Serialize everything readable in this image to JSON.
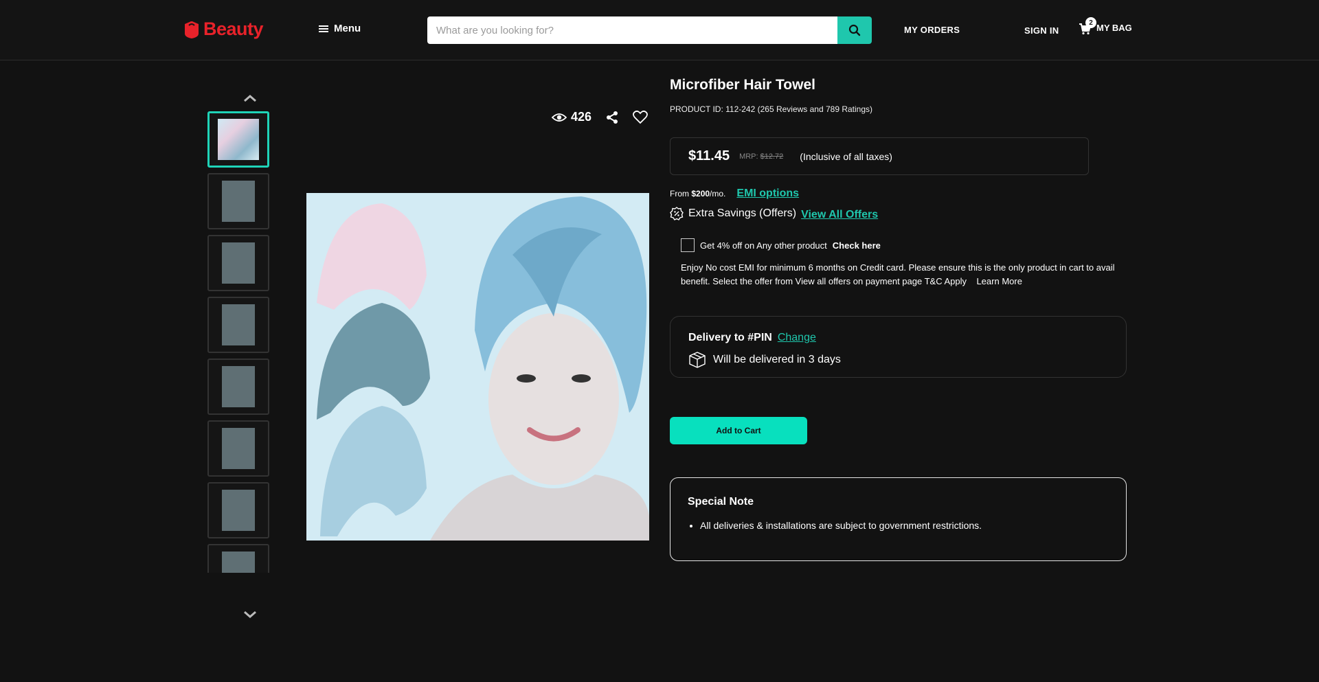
{
  "header": {
    "logo": "Beauty",
    "menu_label": "Menu",
    "search_placeholder": "What are you looking for?",
    "my_orders": "MY ORDERS",
    "sign_in": "SIGN IN",
    "bag_count": "2",
    "bag_label": "MY BAG"
  },
  "gallery": {
    "views": "426",
    "thumbnail_count": 8
  },
  "product": {
    "title": "Microfiber Hair Towel",
    "product_id_line": "PRODUCT ID: 112-242 (265 Reviews and 789 Ratings)",
    "price": "$11.45",
    "mrp_label": "MRP:",
    "mrp_value": "$12.72",
    "tax_note": "(Inclusive of all taxes)",
    "emi_from": "From",
    "emi_amount": "$200",
    "emi_suffix": "/mo.",
    "emi_link": "EMI options",
    "offers_label": "Extra Savings (Offers)",
    "offers_link": "View All Offers",
    "offer_check_text": "Get 4% off on Any other product",
    "offer_check_link": "Check here",
    "offer_desc": "Enjoy No cost EMI for minimum 6 months on Credit card. Please ensure this is the only product in cart to avail benefit. Select the offer from View all offers on payment page T&C Apply",
    "learn_more": "Learn More",
    "delivery_label": "Delivery to #PIN",
    "delivery_change": "Change",
    "delivery_info": "Will be delivered in 3 days",
    "add_to_cart": "Add to Cart",
    "note_title": "Special Note",
    "note_item": "All deliveries & installations are subject to government restrictions."
  },
  "colors": {
    "accent": "#1fc7ad",
    "logo": "#e8222a",
    "background": "#121212"
  }
}
